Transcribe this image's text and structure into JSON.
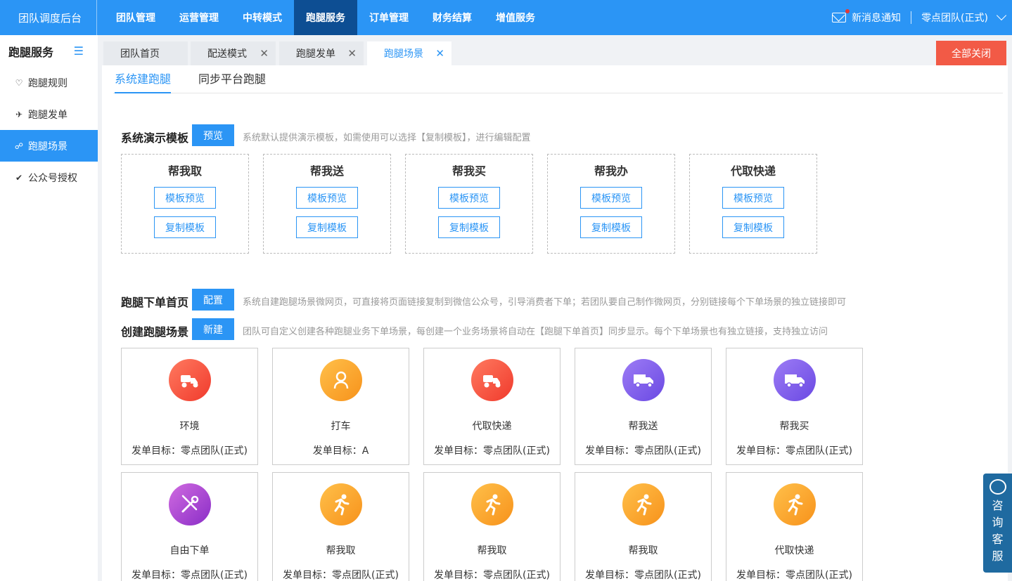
{
  "header": {
    "brand": "团队调度后台",
    "nav": [
      "团队管理",
      "运营管理",
      "中转模式",
      "跑腿服务",
      "订单管理",
      "财务结算",
      "增值服务"
    ],
    "active_nav": "跑腿服务",
    "notice": "新消息通知",
    "team": "零点团队(正式)"
  },
  "sidebar": {
    "title": "跑腿服务",
    "items": [
      {
        "label": "跑腿规则",
        "icon": "stethoscope-icon"
      },
      {
        "label": "跑腿发单",
        "icon": "scooter-icon"
      },
      {
        "label": "跑腿场景",
        "icon": "nodes-icon"
      },
      {
        "label": "公众号授权",
        "icon": "badge-icon"
      }
    ],
    "active": "跑腿场景"
  },
  "tabs": {
    "items": [
      "团队首页",
      "配送模式",
      "跑腿发单",
      "跑腿场景"
    ],
    "active": "跑腿场景",
    "close_all": "全部关闭"
  },
  "subtabs": [
    "系统建跑腿",
    "同步平台跑腿"
  ],
  "demo": {
    "title": "系统演示模板",
    "button": "预览",
    "hint": "系统默认提供演示模板，如需使用可以选择【复制模板】，进行编辑配置",
    "templates": [
      "帮我取",
      "帮我送",
      "帮我买",
      "帮我办",
      "代取快递"
    ],
    "preview_label": "模板预览",
    "copy_label": "复制模板"
  },
  "homepage": {
    "title": "跑腿下单首页",
    "button": "配置",
    "hint": "系统自建跑腿场景微网页，可直接将页面链接复制到微信公众号，引导消费者下单；若团队要自己制作微网页，分别链接每个下单场景的独立链接即可"
  },
  "create": {
    "title": "创建跑腿场景",
    "button": "新建",
    "hint": "团队可自定义创建各种跑腿业务下单场景，每创建一个业务场景将自动在【跑腿下单首页】同步显示。每个下单场景也有独立链接，支持独立访问"
  },
  "scenes": [
    {
      "name": "环境",
      "target": "发单目标：零点团队(正式)",
      "icon": "scooter-icon",
      "color": "red"
    },
    {
      "name": "打车",
      "target": "发单目标：A",
      "icon": "driver-icon",
      "color": "orange"
    },
    {
      "name": "代取快递",
      "target": "发单目标：零点团队(正式)",
      "icon": "scooter-icon",
      "color": "red"
    },
    {
      "name": "帮我送",
      "target": "发单目标：零点团队(正式)",
      "icon": "truck-icon",
      "color": "purple"
    },
    {
      "name": "帮我买",
      "target": "发单目标：零点团队(正式)",
      "icon": "truck-icon",
      "color": "purple"
    },
    {
      "name": "自由下单",
      "target": "发单目标：零点团队(正式)",
      "icon": "tools-icon",
      "color": "violet"
    },
    {
      "name": "帮我取",
      "target": "发单目标：零点团队(正式)",
      "icon": "runner-icon",
      "color": "orange"
    },
    {
      "name": "帮我取",
      "target": "发单目标：零点团队(正式)",
      "icon": "runner-icon",
      "color": "orange"
    },
    {
      "name": "帮我取",
      "target": "发单目标：零点团队(正式)",
      "icon": "runner-icon",
      "color": "orange"
    },
    {
      "name": "代取快递",
      "target": "发单目标：零点团队(正式)",
      "icon": "runner-icon",
      "color": "orange"
    }
  ],
  "consult": "咨询客服"
}
